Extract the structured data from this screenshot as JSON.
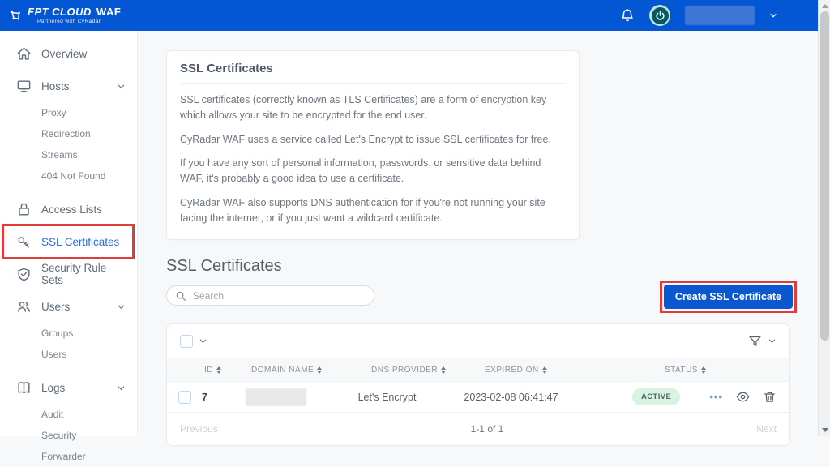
{
  "header": {
    "logo_main": "FPT CLOUD",
    "logo_waf": "WAF",
    "logo_subtitle": "Partnered with CyRadar",
    "icons": [
      "molecule-logo-icon",
      "bell-icon",
      "power-avatar-icon",
      "chevron-down-icon"
    ]
  },
  "sidebar": {
    "items": [
      {
        "label": "Overview",
        "icon": "home-icon"
      },
      {
        "label": "Hosts",
        "icon": "monitor-icon",
        "expanded": true,
        "children": [
          "Proxy",
          "Redirection",
          "Streams",
          "404 Not Found"
        ]
      },
      {
        "label": "Access Lists",
        "icon": "lock-icon"
      },
      {
        "label": "SSL Certificates",
        "icon": "key-icon",
        "active": true,
        "highlighted": true
      },
      {
        "label": "Security Rule Sets",
        "icon": "shield-check-icon"
      },
      {
        "label": "Users",
        "icon": "users-icon",
        "expanded": true,
        "children": [
          "Groups",
          "Users"
        ]
      },
      {
        "label": "Logs",
        "icon": "book-icon",
        "expanded": true,
        "children": [
          "Audit",
          "Security",
          "Forwarder"
        ]
      }
    ]
  },
  "info_card": {
    "title": "SSL Certificates",
    "paragraphs": [
      "SSL certificates (correctly known as TLS Certificates) are a form of encryption key which allows your site to be encrypted for the end user.",
      "CyRadar WAF uses a service called Let's Encrypt to issue SSL certificates for free.",
      "If you have any sort of personal information, passwords, or sensitive data behind WAF, it's probably a good idea to use a certificate.",
      "CyRadar WAF also supports DNS authentication for if you're not running your site facing the internet, or if you just want a wildcard certificate."
    ]
  },
  "main": {
    "section_title": "SSL Certificates",
    "search_placeholder": "Search",
    "create_button_label": "Create SSL Certificate"
  },
  "table": {
    "columns": [
      "ID",
      "DOMAIN NAME",
      "DNS PROVIDER",
      "EXPIRED ON",
      "STATUS"
    ],
    "rows": [
      {
        "id": "7",
        "domain": "",
        "domain_redacted": true,
        "dns_provider": "Let's Encrypt",
        "expired_on": "2023-02-08 06:41:47",
        "status": "ACTIVE",
        "actions": [
          "more-options-icon",
          "view-icon",
          "delete-icon"
        ]
      }
    ],
    "pagination": {
      "previous": "Previous",
      "range": "1-1 of 1",
      "next": "Next"
    }
  },
  "colors": {
    "header_blue": "#0356d4",
    "button_blue": "#0b57d0",
    "active_link_blue": "#2e6fd8",
    "highlight_red": "#e23b3b",
    "badge_green_bg": "#d8f3e1",
    "badge_green_text": "#53655c"
  }
}
